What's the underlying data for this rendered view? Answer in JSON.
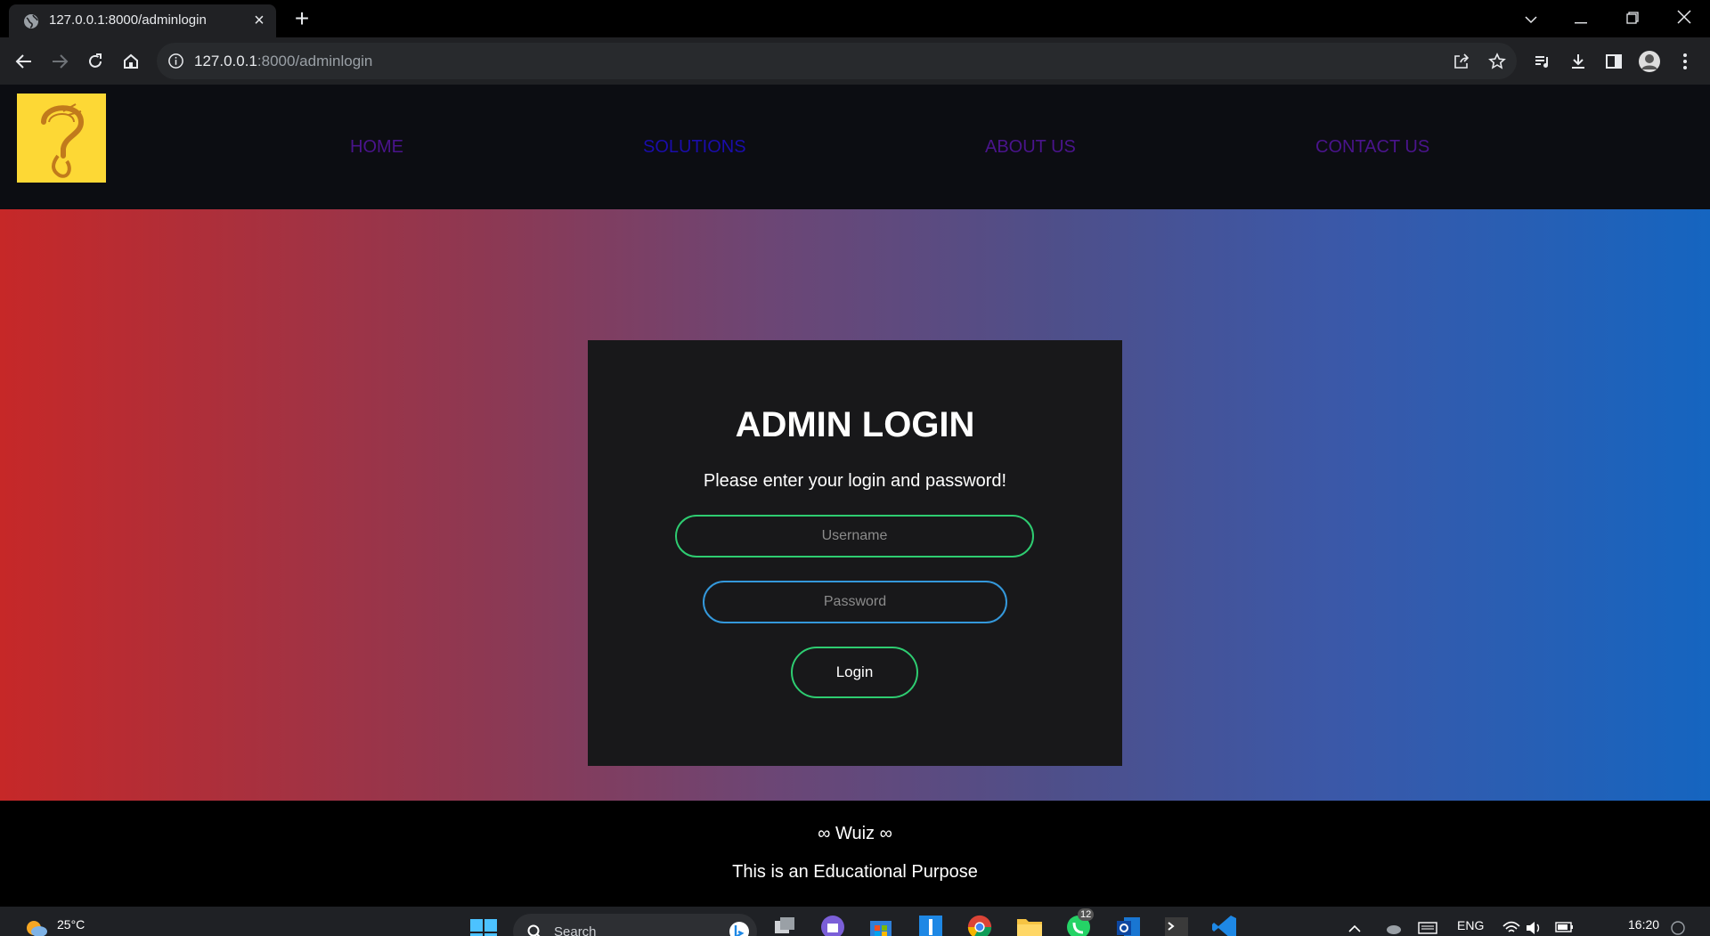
{
  "browser": {
    "tab_title": "127.0.0.1:8000/adminlogin",
    "url_host": "127.0.0.1",
    "url_rest": ":8000/adminlogin"
  },
  "site": {
    "nav": [
      {
        "label": "HOME",
        "color": "#4a148c"
      },
      {
        "label": "SOLUTIONS",
        "color": "#1a0dab"
      },
      {
        "label": "ABOUT US",
        "color": "#4a148c"
      },
      {
        "label": "CONTACT US",
        "color": "#4a148c"
      }
    ],
    "logo_color": "#fdd835"
  },
  "login": {
    "title": "ADMIN LOGIN",
    "subtitle": "Please enter your login and password!",
    "username_placeholder": "Username",
    "password_placeholder": "Password",
    "button_label": "Login"
  },
  "footer": {
    "brand": "∞ Wuiz ∞",
    "note": "This is an Educational Purpose"
  },
  "taskbar": {
    "temperature": "25°C",
    "search_label": "Search",
    "language": "ENG",
    "time": "16:20",
    "whatsapp_badge": "12"
  },
  "colors": {
    "gradient_left": "#c62828",
    "gradient_right": "#1565c0",
    "accent_green": "#2ecc71",
    "accent_blue": "#3498db"
  }
}
